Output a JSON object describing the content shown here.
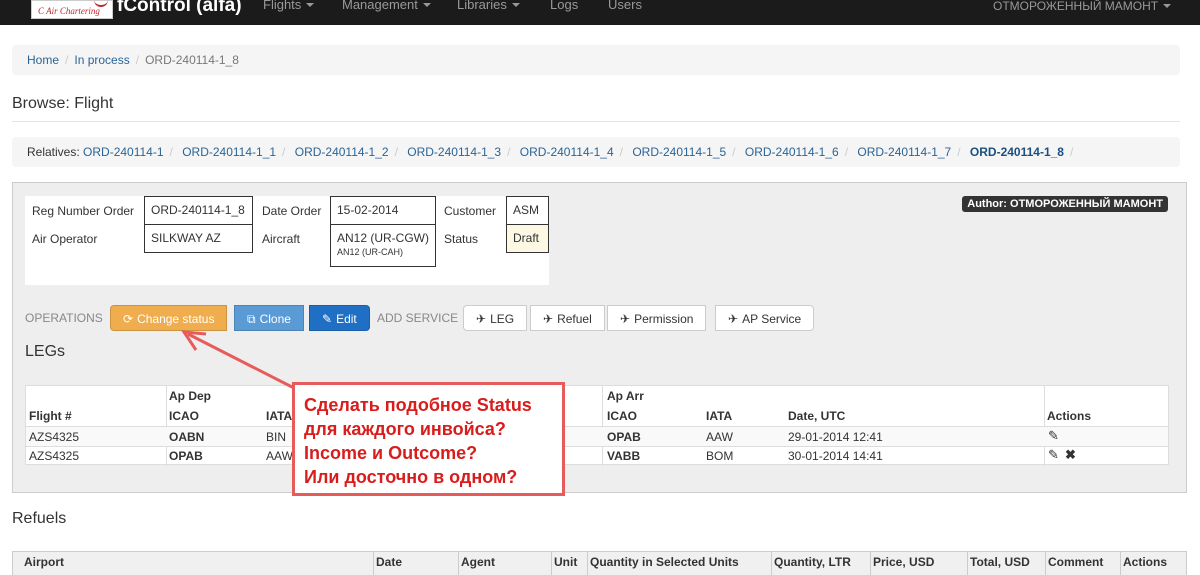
{
  "nav": {
    "logo_text": "C Air Chartering",
    "brand": "fControl (alfa)",
    "items": [
      "Flights",
      "Management",
      "Libraries",
      "Logs",
      "Users"
    ],
    "user": "ОТМОРОЖЕННЫЙ МАМОНТ"
  },
  "breadcrumb": {
    "home": "Home",
    "in_process": "In process",
    "current": "ORD-240114-1_8"
  },
  "page_title": "Browse: Flight",
  "relatives": {
    "label": "Relatives:",
    "items": [
      "ORD-240114-1",
      "ORD-240114-1_1",
      "ORD-240114-1_2",
      "ORD-240114-1_3",
      "ORD-240114-1_4",
      "ORD-240114-1_5",
      "ORD-240114-1_6",
      "ORD-240114-1_7",
      "ORD-240114-1_8"
    ]
  },
  "author": "Author: ОТМОРОЖЕННЫЙ МАМОНТ",
  "info": {
    "reg_number_label": "Reg Number Order",
    "reg_number": "ORD-240114-1_8",
    "date_order_label": "Date Order",
    "date_order": "15-02-2014",
    "customer_label": "Customer",
    "customer": "ASM",
    "air_operator_label": "Air Operator",
    "air_operator": "SILKWAY AZ",
    "aircraft_label": "Aircraft",
    "aircraft": "AN12 (UR-CGW)",
    "aircraft_sub": "AN12 (UR-CAH)",
    "status_label": "Status",
    "status": "Draft"
  },
  "operations": {
    "label": "OPERATIONS",
    "change_status": "Change status",
    "clone": "Clone",
    "edit": "Edit",
    "add_service_label": "ADD SERVICE",
    "leg": "LEG",
    "refuel": "Refuel",
    "permission": "Permission",
    "ap_service": "AP Service"
  },
  "legs": {
    "title": "LEGs",
    "group_dep": "Ap Dep",
    "group_arr": "Ap Arr",
    "headers": {
      "flight": "Flight #",
      "icao_dep": "ICAO",
      "iata_dep": "IATA",
      "icao_arr": "ICAO",
      "iata_arr": "IATA",
      "date": "Date, UTC",
      "actions": "Actions"
    },
    "rows": [
      {
        "flight": "AZS4325",
        "icao_dep": "OABN",
        "iata_dep": "BIN",
        "icao_arr": "OPAB",
        "iata_arr": "AAW",
        "date": "29-01-2014 12:41"
      },
      {
        "flight": "AZS4325",
        "icao_dep": "OPAB",
        "iata_dep": "AAW",
        "icao_arr": "VABB",
        "iata_arr": "BOM",
        "date": "30-01-2014 14:41"
      }
    ]
  },
  "refuels": {
    "title": "Refuels",
    "headers": [
      "Airport",
      "Date",
      "Agent",
      "Unit",
      "Quantity in Selected Units",
      "Quantity, LTR",
      "Price, USD",
      "Total, USD",
      "Comment",
      "Actions"
    ]
  },
  "annotation": {
    "lines": [
      "Сделать подобное Status",
      "для каждого инвойса?",
      "Income и Outcome?",
      "Или досточно в одном?"
    ]
  },
  "colors": {
    "navbar": "#1b1b1b",
    "warning": "#f0ad4e",
    "info": "#5b9bd5",
    "primary": "#1f6fc4",
    "annotation": "#e85b5b"
  }
}
